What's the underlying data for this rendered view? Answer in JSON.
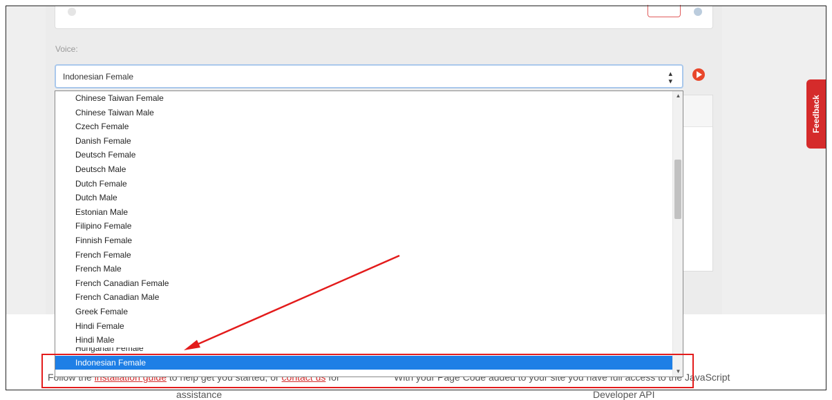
{
  "voice": {
    "label": "Voice:",
    "selected": "Indonesian Female"
  },
  "dropdown": {
    "items": [
      "Chinese Taiwan Female",
      "Chinese Taiwan Male",
      "Czech Female",
      "Danish Female",
      "Deutsch Female",
      "Deutsch Male",
      "Dutch Female",
      "Dutch Male",
      "Estonian Male",
      "Filipino Female",
      "Finnish Female",
      "French Female",
      "French Male",
      "French Canadian Female",
      "French Canadian Male",
      "Greek Female",
      "Hindi Female",
      "Hindi Male",
      "Hungarian Female",
      "Indonesian Female"
    ],
    "selected_index": 19
  },
  "feedback": {
    "label": "Feedback"
  },
  "footer": {
    "left_prefix": "Follow the",
    "left_link1": "installation guide",
    "left_mid": "to help get you started, or",
    "left_link2": "contact us",
    "left_suffix": "for",
    "left_line2": "assistance",
    "right_line1": "With your Page Code added to your site you have full access to the JavaScript",
    "right_line2": "Developer API"
  },
  "colors": {
    "accent_red": "#d52b2b",
    "selected_blue": "#1e7fe6",
    "annotation_red": "#e31b1b"
  }
}
